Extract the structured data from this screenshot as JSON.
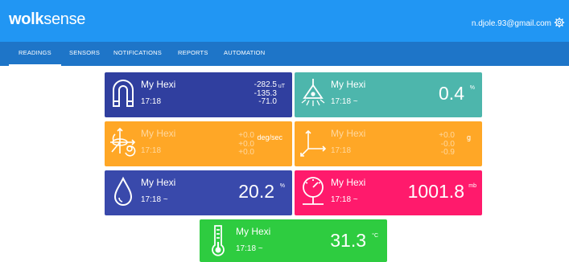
{
  "header": {
    "logo_bold": "wolk",
    "logo_light": "sense",
    "user_email": "n.djole.93@gmail.com",
    "icons": {
      "settings": "gear-icon"
    }
  },
  "nav": {
    "items": [
      {
        "label": "READINGS",
        "active": true
      },
      {
        "label": "SENSORS"
      },
      {
        "label": "NOTIFICATIONS"
      },
      {
        "label": "REPORTS"
      },
      {
        "label": "AUTOMATION"
      }
    ]
  },
  "colors": {
    "topbar": "#2196f3",
    "navbar": "#1e75c8",
    "magnetometer": "#303f9f",
    "light": "#4db6ac",
    "gyroscope": "#ffa726",
    "accelerometer": "#ffa726",
    "humidity": "#3949ab",
    "pressure": "#ff1a6c",
    "temperature": "#2ecc40"
  },
  "tiles": {
    "magnetometer": {
      "icon": "magnet-icon",
      "name": "My Hexi",
      "time": "17:18",
      "values": [
        "-282.5",
        "-135.3",
        "-71.0"
      ],
      "unit": "uT"
    },
    "light": {
      "icon": "lamp-icon",
      "name": "My Hexi",
      "time": "17:18 ~",
      "value": "0.4",
      "unit": "%"
    },
    "gyroscope": {
      "icon": "gyroscope-icon",
      "name": "My Hexi",
      "time": "17:18",
      "values": [
        "+0.0",
        "+0.0",
        "+0.0"
      ],
      "unit": "deg/sec"
    },
    "accelerometer": {
      "icon": "axes-icon",
      "name": "My Hexi",
      "time": "17:18",
      "values": [
        "+0.0",
        "-0.0",
        "-0.9"
      ],
      "unit": "g"
    },
    "humidity": {
      "icon": "droplet-icon",
      "name": "My Hexi",
      "time": "17:18 ~",
      "value": "20.2",
      "unit": "%"
    },
    "pressure": {
      "icon": "barometer-icon",
      "name": "My Hexi",
      "time": "17:18 ~",
      "value": "1001.8",
      "unit": "mb"
    },
    "temperature": {
      "icon": "thermometer-icon",
      "name": "My Hexi",
      "time": "17:18 ~",
      "value": "31.3",
      "unit": "°C"
    }
  }
}
